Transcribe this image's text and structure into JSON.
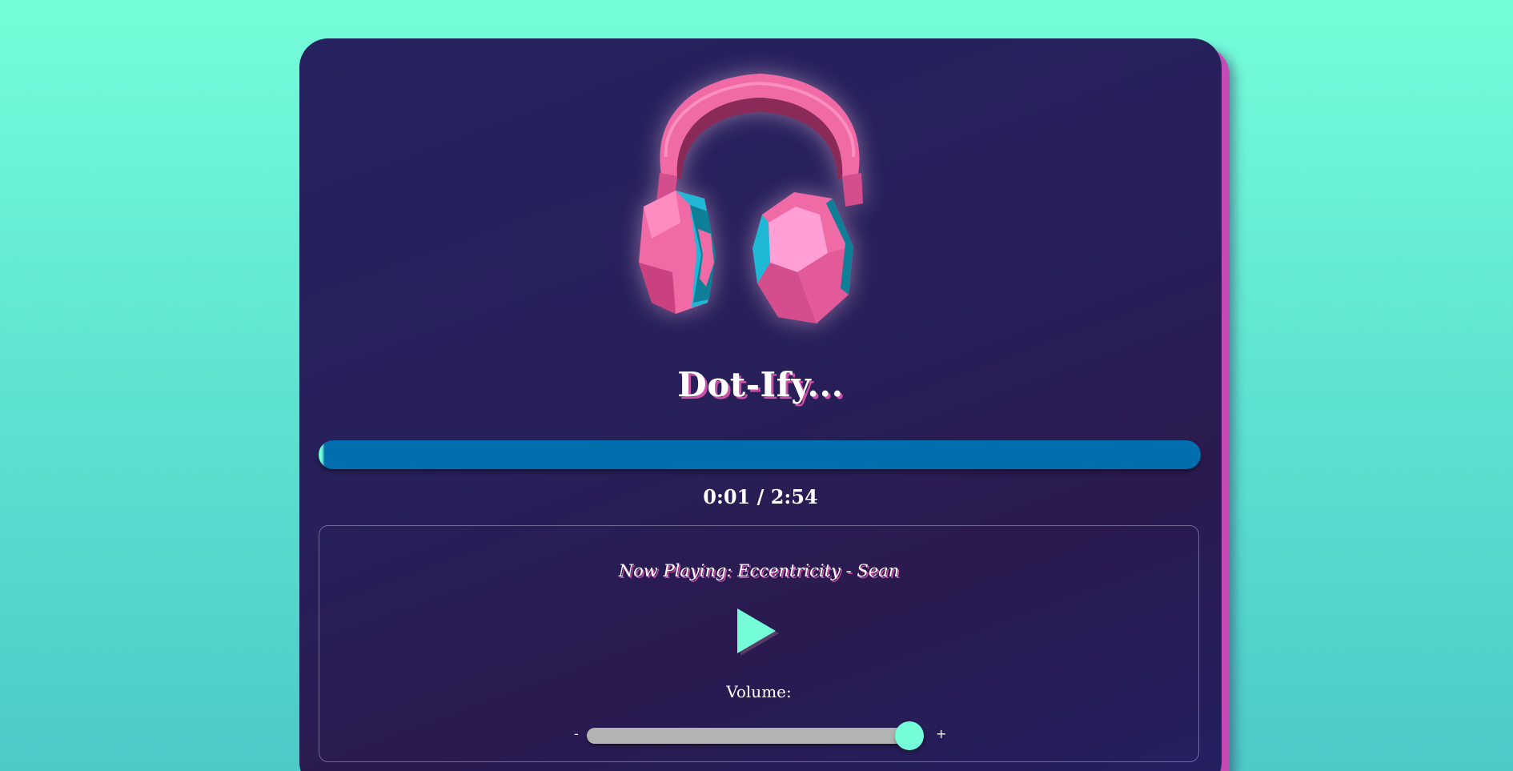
{
  "app": {
    "title": "Dot-Ify..."
  },
  "player": {
    "current_time": "0:01",
    "duration": "2:54",
    "time_display": "0:01 / 2:54",
    "progress_percent": 0.6,
    "now_playing": "Now Playing: Eccentricity - Sean",
    "play_button_icon": "play-icon",
    "album_art_icon": "headphones-icon"
  },
  "volume": {
    "label": "Volume:",
    "min_symbol": "-",
    "max_symbol": "+",
    "level_percent": 96
  },
  "colors": {
    "page_background": "#75fdd9",
    "card_background": "#25225f",
    "card_shadow": "#c64ab5",
    "accent": "#75fdd9",
    "progress_track": "#016fae",
    "title_shadow": "#c94fa6",
    "headphones_pink": "#f26aa8",
    "headphones_cyan": "#1fb8d6",
    "volume_track": "#b3b3b3"
  }
}
